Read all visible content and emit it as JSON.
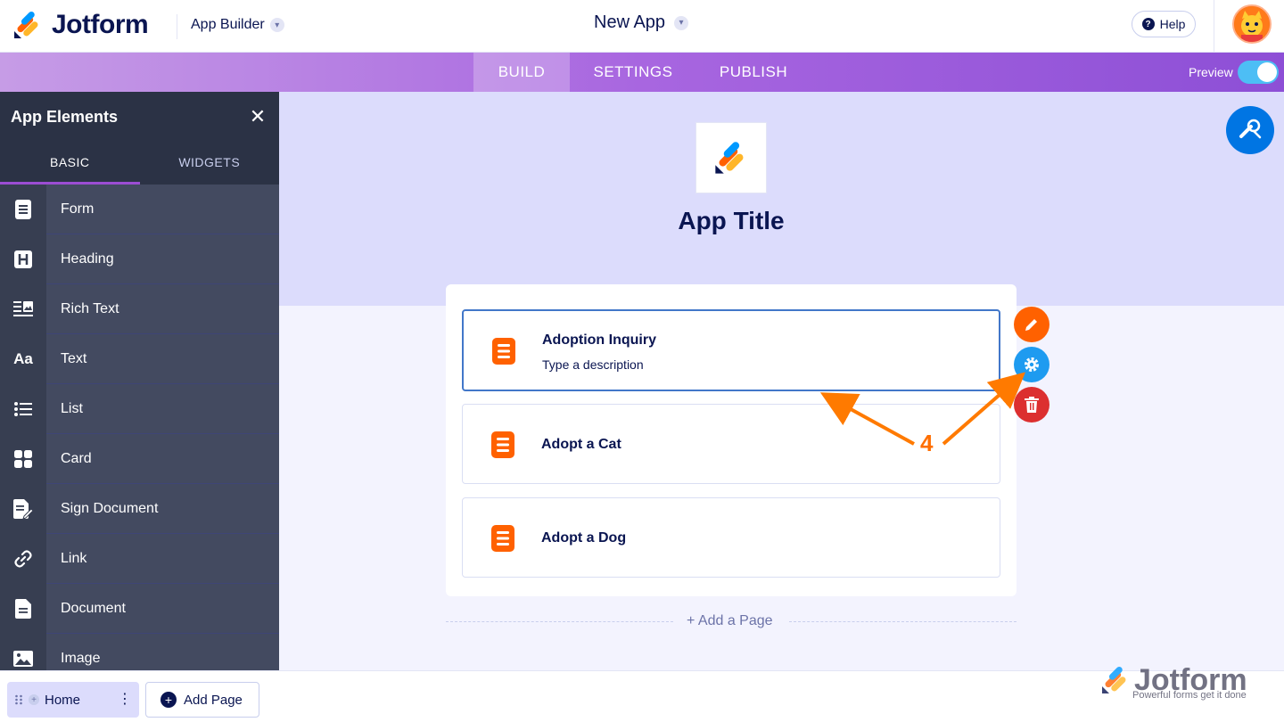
{
  "header": {
    "brand": "Jotform",
    "app_builder_label": "App Builder",
    "app_name": "New App",
    "help_label": "Help"
  },
  "nav": {
    "tabs": [
      {
        "label": "BUILD",
        "active": true
      },
      {
        "label": "SETTINGS",
        "active": false
      },
      {
        "label": "PUBLISH",
        "active": false
      }
    ],
    "preview_label": "Preview",
    "preview_on": true
  },
  "sidebar": {
    "title": "App Elements",
    "tabs": [
      {
        "label": "BASIC",
        "active": true
      },
      {
        "label": "WIDGETS",
        "active": false
      }
    ],
    "items": [
      {
        "label": "Form",
        "icon": "form-icon"
      },
      {
        "label": "Heading",
        "icon": "heading-icon"
      },
      {
        "label": "Rich Text",
        "icon": "rich-text-icon"
      },
      {
        "label": "Text",
        "icon": "text-icon"
      },
      {
        "label": "List",
        "icon": "list-icon"
      },
      {
        "label": "Card",
        "icon": "card-icon"
      },
      {
        "label": "Sign Document",
        "icon": "sign-document-icon"
      },
      {
        "label": "Link",
        "icon": "link-icon"
      },
      {
        "label": "Document",
        "icon": "document-icon"
      },
      {
        "label": "Image",
        "icon": "image-icon"
      }
    ]
  },
  "canvas": {
    "app_title": "App Title",
    "pages": [
      {
        "title": "Adoption Inquiry",
        "description": "Type a description",
        "selected": true
      },
      {
        "title": "Adopt a Cat",
        "description": "",
        "selected": false
      },
      {
        "title": "Adopt a Dog",
        "description": "",
        "selected": false
      }
    ],
    "add_page_link": "+  Add a Page"
  },
  "annotation": {
    "number": "4"
  },
  "bottombar": {
    "home_label": "Home",
    "add_page_label": "Add Page"
  },
  "watermark": {
    "brand": "Jotform",
    "tagline": "Powerful forms get it done"
  },
  "colors": {
    "brand_orange": "#ff6100",
    "accent_blue": "#0075e3",
    "delete_red": "#dc2f2f",
    "nav_purple": "#a866e0"
  }
}
